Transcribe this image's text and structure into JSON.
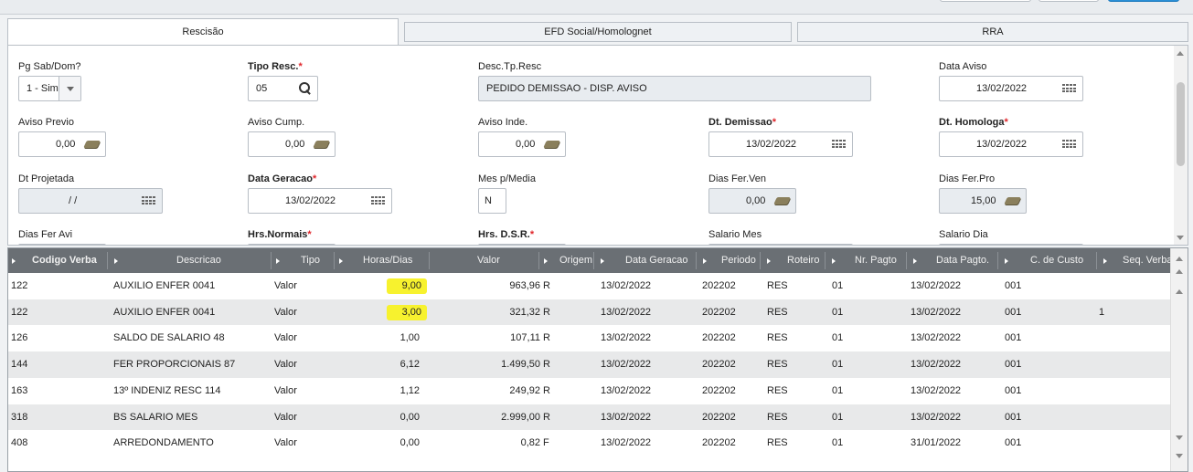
{
  "tabs": [
    "Rescisão",
    "EFD Social/Homolognet",
    "RRA"
  ],
  "form": {
    "pg_sab_dom": {
      "label": "Pg Sab/Dom?",
      "value": "1 - Sim"
    },
    "tipo_resc": {
      "label": "Tipo Resc.",
      "value": "05"
    },
    "desc_tp_resc": {
      "label": "Desc.Tp.Resc",
      "value": "PEDIDO DEMISSAO - DISP. AVISO"
    },
    "data_aviso": {
      "label": "Data Aviso",
      "value": "13/02/2022"
    },
    "aviso_previo": {
      "label": "Aviso Previo",
      "value": "0,00"
    },
    "aviso_cump": {
      "label": "Aviso Cump.",
      "value": "0,00"
    },
    "aviso_inde": {
      "label": "Aviso Inde.",
      "value": "0,00"
    },
    "dt_demissao": {
      "label": "Dt. Demissao",
      "value": "13/02/2022"
    },
    "dt_homologa": {
      "label": "Dt. Homologa",
      "value": "13/02/2022"
    },
    "dt_projetada": {
      "label": "Dt Projetada",
      "value": "/ /"
    },
    "data_geracao": {
      "label": "Data Geracao",
      "value": "13/02/2022"
    },
    "mes_p_media": {
      "label": "Mes p/Media",
      "value": "N"
    },
    "dias_fer_ven": {
      "label": "Dias Fer.Ven",
      "value": "0,00"
    },
    "dias_fer_pro": {
      "label": "Dias Fer.Pro",
      "value": "15,00"
    },
    "dias_fer_avi": {
      "label": "Dias Fer Avi"
    },
    "hrs_normais": {
      "label": "Hrs.Normais"
    },
    "hrs_dsr": {
      "label": "Hrs. D.S.R."
    },
    "salario_mes": {
      "label": "Salario Mes"
    },
    "salario_dia": {
      "label": "Salario Dia"
    },
    "required_mark": "*"
  },
  "grid": {
    "headers": [
      "Codigo Verba",
      "Descricao",
      "Tipo",
      "Horas/Dias",
      "Valor",
      "Origem",
      "Data Geracao",
      "Periodo",
      "Roteiro",
      "Nr. Pagto",
      "Data Pagto.",
      "C. de Custo",
      "Seq. Verba"
    ],
    "rows": [
      {
        "codigo": "122",
        "descricao": "AUXILIO ENFER 0041",
        "tipo": "Valor",
        "horas": "9,00",
        "valor": "963,96",
        "origem": "R",
        "data_geracao": "13/02/2022",
        "periodo": "202202",
        "roteiro": "RES",
        "nr_pagto": "01",
        "data_pagto": "13/02/2022",
        "ccusto": "001",
        "seq": "",
        "highlight": true
      },
      {
        "codigo": "122",
        "descricao": "AUXILIO ENFER 0041",
        "tipo": "Valor",
        "horas": "3,00",
        "valor": "321,32",
        "origem": "R",
        "data_geracao": "13/02/2022",
        "periodo": "202202",
        "roteiro": "RES",
        "nr_pagto": "01",
        "data_pagto": "13/02/2022",
        "ccusto": "001",
        "seq": "1",
        "highlight": true
      },
      {
        "codigo": "126",
        "descricao": "SALDO DE SALARIO 48",
        "tipo": "Valor",
        "horas": "1,00",
        "valor": "107,11",
        "origem": "R",
        "data_geracao": "13/02/2022",
        "periodo": "202202",
        "roteiro": "RES",
        "nr_pagto": "01",
        "data_pagto": "13/02/2022",
        "ccusto": "001",
        "seq": "",
        "highlight": false
      },
      {
        "codigo": "144",
        "descricao": "FER PROPORCIONAIS 87",
        "tipo": "Valor",
        "horas": "6,12",
        "valor": "1.499,50",
        "origem": "R",
        "data_geracao": "13/02/2022",
        "periodo": "202202",
        "roteiro": "RES",
        "nr_pagto": "01",
        "data_pagto": "13/02/2022",
        "ccusto": "001",
        "seq": "",
        "highlight": false
      },
      {
        "codigo": "163",
        "descricao": "13º INDENIZ RESC 114",
        "tipo": "Valor",
        "horas": "1,12",
        "valor": "249,92",
        "origem": "R",
        "data_geracao": "13/02/2022",
        "periodo": "202202",
        "roteiro": "RES",
        "nr_pagto": "01",
        "data_pagto": "13/02/2022",
        "ccusto": "001",
        "seq": "",
        "highlight": false
      },
      {
        "codigo": "318",
        "descricao": "BS SALARIO MES",
        "tipo": "Valor",
        "horas": "0,00",
        "valor": "2.999,00",
        "origem": "R",
        "data_geracao": "13/02/2022",
        "periodo": "202202",
        "roteiro": "RES",
        "nr_pagto": "01",
        "data_pagto": "13/02/2022",
        "ccusto": "001",
        "seq": "",
        "highlight": false
      },
      {
        "codigo": "408",
        "descricao": "ARREDONDAMENTO",
        "tipo": "Valor",
        "horas": "0,00",
        "valor": "0,82",
        "origem": "F",
        "data_geracao": "13/02/2022",
        "periodo": "202202",
        "roteiro": "RES",
        "nr_pagto": "01",
        "data_pagto": "31/01/2022",
        "ccusto": "001",
        "seq": "",
        "highlight": false
      }
    ]
  },
  "colors": {
    "highlight": "#f7f22e",
    "header_bg": "#6a6f74",
    "required": "#e0262b",
    "primary_button": "#2a8fd6"
  }
}
